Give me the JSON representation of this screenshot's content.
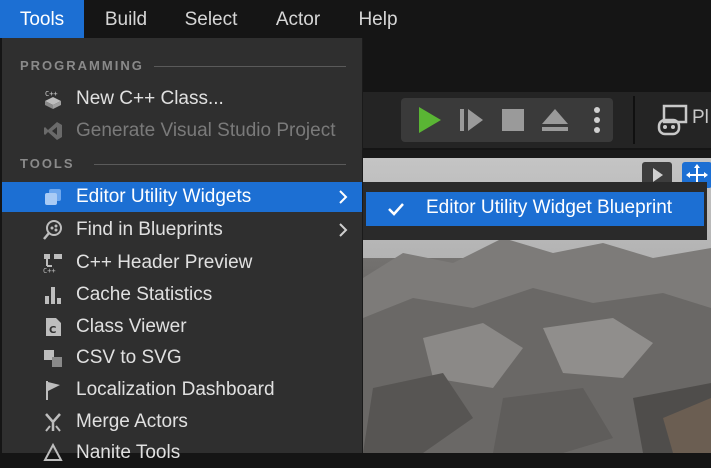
{
  "menubar": {
    "items": [
      "Tools",
      "Build",
      "Select",
      "Actor",
      "Help"
    ]
  },
  "toolbar": {
    "platforms_label": "Pl"
  },
  "tools_menu": {
    "sections": [
      "PROGRAMMING",
      "TOOLS"
    ],
    "items": [
      {
        "label": "New C++ Class...",
        "icon": "cpp-class-icon"
      },
      {
        "label": "Generate Visual Studio Project",
        "icon": "visual-studio-icon",
        "disabled": true
      },
      {
        "label": "Editor Utility Widgets",
        "icon": "utility-widget-icon",
        "submenu": true,
        "highlighted": true
      },
      {
        "label": "Find in Blueprints",
        "icon": "find-blueprint-icon",
        "submenu": true
      },
      {
        "label": "C++ Header Preview",
        "icon": "cpp-header-icon"
      },
      {
        "label": "Cache Statistics",
        "icon": "bar-chart-icon"
      },
      {
        "label": "Class Viewer",
        "icon": "class-viewer-icon"
      },
      {
        "label": "CSV to SVG",
        "icon": "csv-svg-icon"
      },
      {
        "label": "Localization Dashboard",
        "icon": "flag-icon"
      },
      {
        "label": "Merge Actors",
        "icon": "merge-icon"
      },
      {
        "label": "Nanite Tools",
        "icon": "nanite-icon"
      }
    ]
  },
  "submenu": {
    "item_label": "Editor Utility Widget Blueprint"
  },
  "colors": {
    "accent": "#1c6fd3",
    "menu_bg": "#2f2f2f",
    "bar_bg": "#151515",
    "play_green": "#5ab534"
  }
}
